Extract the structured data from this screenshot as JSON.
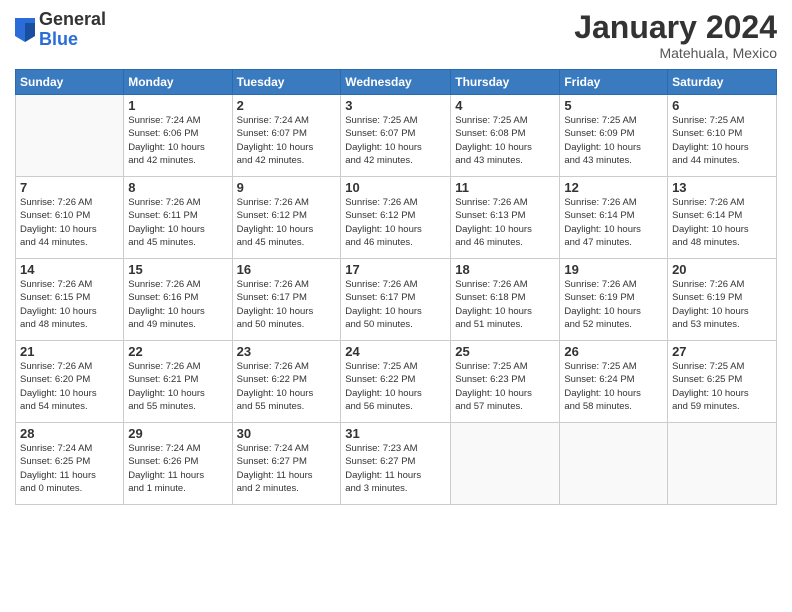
{
  "header": {
    "logo": {
      "general": "General",
      "blue": "Blue"
    },
    "title": "January 2024",
    "location": "Matehuala, Mexico"
  },
  "days_of_week": [
    "Sunday",
    "Monday",
    "Tuesday",
    "Wednesday",
    "Thursday",
    "Friday",
    "Saturday"
  ],
  "weeks": [
    [
      {
        "day": "",
        "info": ""
      },
      {
        "day": "1",
        "info": "Sunrise: 7:24 AM\nSunset: 6:06 PM\nDaylight: 10 hours\nand 42 minutes."
      },
      {
        "day": "2",
        "info": "Sunrise: 7:24 AM\nSunset: 6:07 PM\nDaylight: 10 hours\nand 42 minutes."
      },
      {
        "day": "3",
        "info": "Sunrise: 7:25 AM\nSunset: 6:07 PM\nDaylight: 10 hours\nand 42 minutes."
      },
      {
        "day": "4",
        "info": "Sunrise: 7:25 AM\nSunset: 6:08 PM\nDaylight: 10 hours\nand 43 minutes."
      },
      {
        "day": "5",
        "info": "Sunrise: 7:25 AM\nSunset: 6:09 PM\nDaylight: 10 hours\nand 43 minutes."
      },
      {
        "day": "6",
        "info": "Sunrise: 7:25 AM\nSunset: 6:10 PM\nDaylight: 10 hours\nand 44 minutes."
      }
    ],
    [
      {
        "day": "7",
        "info": "Sunrise: 7:26 AM\nSunset: 6:10 PM\nDaylight: 10 hours\nand 44 minutes."
      },
      {
        "day": "8",
        "info": "Sunrise: 7:26 AM\nSunset: 6:11 PM\nDaylight: 10 hours\nand 45 minutes."
      },
      {
        "day": "9",
        "info": "Sunrise: 7:26 AM\nSunset: 6:12 PM\nDaylight: 10 hours\nand 45 minutes."
      },
      {
        "day": "10",
        "info": "Sunrise: 7:26 AM\nSunset: 6:12 PM\nDaylight: 10 hours\nand 46 minutes."
      },
      {
        "day": "11",
        "info": "Sunrise: 7:26 AM\nSunset: 6:13 PM\nDaylight: 10 hours\nand 46 minutes."
      },
      {
        "day": "12",
        "info": "Sunrise: 7:26 AM\nSunset: 6:14 PM\nDaylight: 10 hours\nand 47 minutes."
      },
      {
        "day": "13",
        "info": "Sunrise: 7:26 AM\nSunset: 6:14 PM\nDaylight: 10 hours\nand 48 minutes."
      }
    ],
    [
      {
        "day": "14",
        "info": "Sunrise: 7:26 AM\nSunset: 6:15 PM\nDaylight: 10 hours\nand 48 minutes."
      },
      {
        "day": "15",
        "info": "Sunrise: 7:26 AM\nSunset: 6:16 PM\nDaylight: 10 hours\nand 49 minutes."
      },
      {
        "day": "16",
        "info": "Sunrise: 7:26 AM\nSunset: 6:17 PM\nDaylight: 10 hours\nand 50 minutes."
      },
      {
        "day": "17",
        "info": "Sunrise: 7:26 AM\nSunset: 6:17 PM\nDaylight: 10 hours\nand 50 minutes."
      },
      {
        "day": "18",
        "info": "Sunrise: 7:26 AM\nSunset: 6:18 PM\nDaylight: 10 hours\nand 51 minutes."
      },
      {
        "day": "19",
        "info": "Sunrise: 7:26 AM\nSunset: 6:19 PM\nDaylight: 10 hours\nand 52 minutes."
      },
      {
        "day": "20",
        "info": "Sunrise: 7:26 AM\nSunset: 6:19 PM\nDaylight: 10 hours\nand 53 minutes."
      }
    ],
    [
      {
        "day": "21",
        "info": "Sunrise: 7:26 AM\nSunset: 6:20 PM\nDaylight: 10 hours\nand 54 minutes."
      },
      {
        "day": "22",
        "info": "Sunrise: 7:26 AM\nSunset: 6:21 PM\nDaylight: 10 hours\nand 55 minutes."
      },
      {
        "day": "23",
        "info": "Sunrise: 7:26 AM\nSunset: 6:22 PM\nDaylight: 10 hours\nand 55 minutes."
      },
      {
        "day": "24",
        "info": "Sunrise: 7:25 AM\nSunset: 6:22 PM\nDaylight: 10 hours\nand 56 minutes."
      },
      {
        "day": "25",
        "info": "Sunrise: 7:25 AM\nSunset: 6:23 PM\nDaylight: 10 hours\nand 57 minutes."
      },
      {
        "day": "26",
        "info": "Sunrise: 7:25 AM\nSunset: 6:24 PM\nDaylight: 10 hours\nand 58 minutes."
      },
      {
        "day": "27",
        "info": "Sunrise: 7:25 AM\nSunset: 6:25 PM\nDaylight: 10 hours\nand 59 minutes."
      }
    ],
    [
      {
        "day": "28",
        "info": "Sunrise: 7:24 AM\nSunset: 6:25 PM\nDaylight: 11 hours\nand 0 minutes."
      },
      {
        "day": "29",
        "info": "Sunrise: 7:24 AM\nSunset: 6:26 PM\nDaylight: 11 hours\nand 1 minute."
      },
      {
        "day": "30",
        "info": "Sunrise: 7:24 AM\nSunset: 6:27 PM\nDaylight: 11 hours\nand 2 minutes."
      },
      {
        "day": "31",
        "info": "Sunrise: 7:23 AM\nSunset: 6:27 PM\nDaylight: 11 hours\nand 3 minutes."
      },
      {
        "day": "",
        "info": ""
      },
      {
        "day": "",
        "info": ""
      },
      {
        "day": "",
        "info": ""
      }
    ]
  ]
}
